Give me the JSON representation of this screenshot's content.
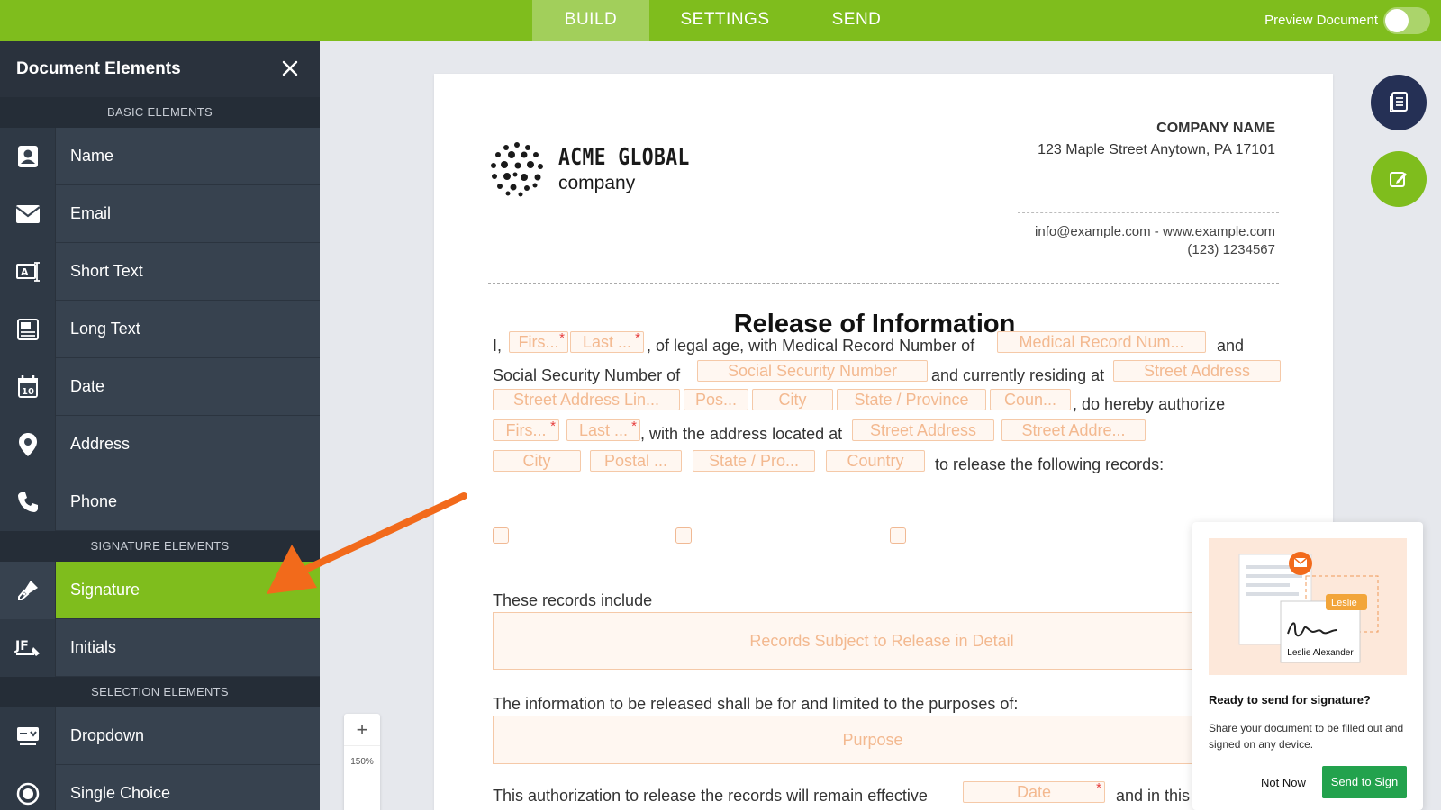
{
  "topbar": {
    "tabs": [
      {
        "label": "BUILD",
        "active": true
      },
      {
        "label": "SETTINGS",
        "active": false
      },
      {
        "label": "SEND",
        "active": false
      }
    ],
    "preview_label": "Preview Document"
  },
  "sidebar": {
    "title": "Document Elements",
    "sections": {
      "basic": "BASIC ELEMENTS",
      "signature": "SIGNATURE ELEMENTS",
      "selection": "SELECTION ELEMENTS"
    },
    "items": {
      "name": "Name",
      "email": "Email",
      "short_text": "Short Text",
      "long_text": "Long Text",
      "date": "Date",
      "address": "Address",
      "phone": "Phone",
      "signature": "Signature",
      "initials": "Initials",
      "dropdown": "Dropdown",
      "single_choice": "Single Choice"
    },
    "date_icon_number": "10",
    "colors": {
      "accent": "#7fbd1d",
      "panel": "#37424f"
    }
  },
  "document": {
    "logo": {
      "line1": "ACME GLOBAL",
      "line2": "company"
    },
    "header": {
      "company": "COMPANY NAME",
      "street": "123 Maple Street Anytown, PA 17101",
      "contact": "info@example.com - www.example.com",
      "phone": "(123) 1234567"
    },
    "title": "Release of Information",
    "text": {
      "i": "I,",
      "legal_age": ", of legal age, with Medical Record Number of",
      "and": "and",
      "ssn_prefix": "Social Security Number of",
      "residing": "and currently residing at",
      "authorize": ", do hereby authorize",
      "address_located": ", with the address located at",
      "release_records": "to release the following records:",
      "records_include": "These records include",
      "purposes": "The information to be released shall be for and limited to the purposes of:",
      "effective": "This authorization to release the records will remain effective",
      "in_this": "and in this"
    },
    "fields": {
      "first1": "Firs...",
      "last1": "Last ...",
      "mrn": "Medical Record Num...",
      "ssn": "Social Security Number",
      "street1": "Street Address",
      "street_line2": "Street Address Lin...",
      "postal1": "Pos...",
      "city1": "City",
      "state1": "State / Province",
      "country1": "Coun...",
      "first2": "Firs...",
      "last2": "Last ...",
      "street2": "Street Address",
      "street2b": "Street Addre...",
      "city2": "City",
      "postal2": "Postal ...",
      "state2": "State / Pro...",
      "country2": "Country",
      "records": "Records Subject to Release in Detail",
      "purpose": "Purpose",
      "date": "Date"
    },
    "required_mark": "*"
  },
  "zoom": {
    "plus": "+",
    "level": "150%"
  },
  "popup": {
    "badge_name": "Leslie",
    "signer_name": "Leslie Alexander",
    "heading": "Ready to send for signature?",
    "body": "Share your document to be filled out and signed on any device.",
    "not_now": "Not Now",
    "send_to_sign": "Send to Sign"
  }
}
